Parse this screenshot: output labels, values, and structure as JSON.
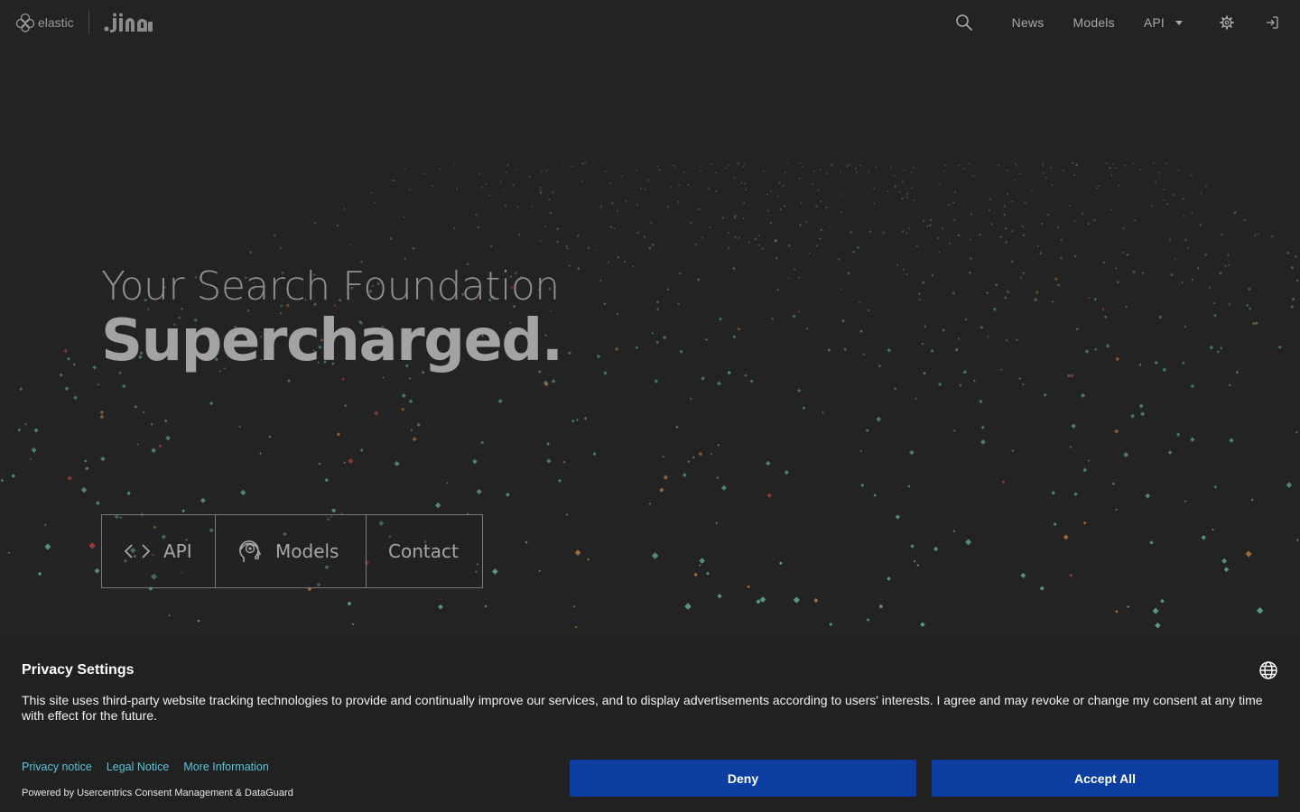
{
  "header": {
    "elastic_label": "elastic",
    "jina_logo": "jina",
    "nav": {
      "news": "News",
      "models": "Models",
      "api": "API"
    },
    "icons": [
      "search-icon",
      "settings-gear-icon",
      "sign-in-icon"
    ]
  },
  "hero": {
    "line1": "Your Search Foundation",
    "line2": "Supercharged.",
    "buttons": [
      {
        "label": "API",
        "icon": "code-brackets-icon"
      },
      {
        "label": "Models",
        "icon": "head-brain-icon"
      },
      {
        "label": "Contact",
        "icon": ""
      }
    ]
  },
  "privacy": {
    "title": "Privacy Settings",
    "text": "This site uses third-party website tracking technologies to provide and continually improve our services, and to display advertisements according to users' interests. I agree and may revoke or change my consent at any time with effect for the future.",
    "links": [
      "Privacy notice",
      "Legal Notice",
      "More Information"
    ],
    "powered_by": "Powered by Usercentrics Consent Management & DataGuard",
    "deny_label": "Deny",
    "accept_label": "Accept All",
    "button_color": "#0b3ea0",
    "link_color": "#58c4dc"
  },
  "colors": {
    "background": "#232323",
    "particle_teal": "#5fa894",
    "particle_orange": "#c07a3a",
    "particle_red": "#b04040"
  }
}
